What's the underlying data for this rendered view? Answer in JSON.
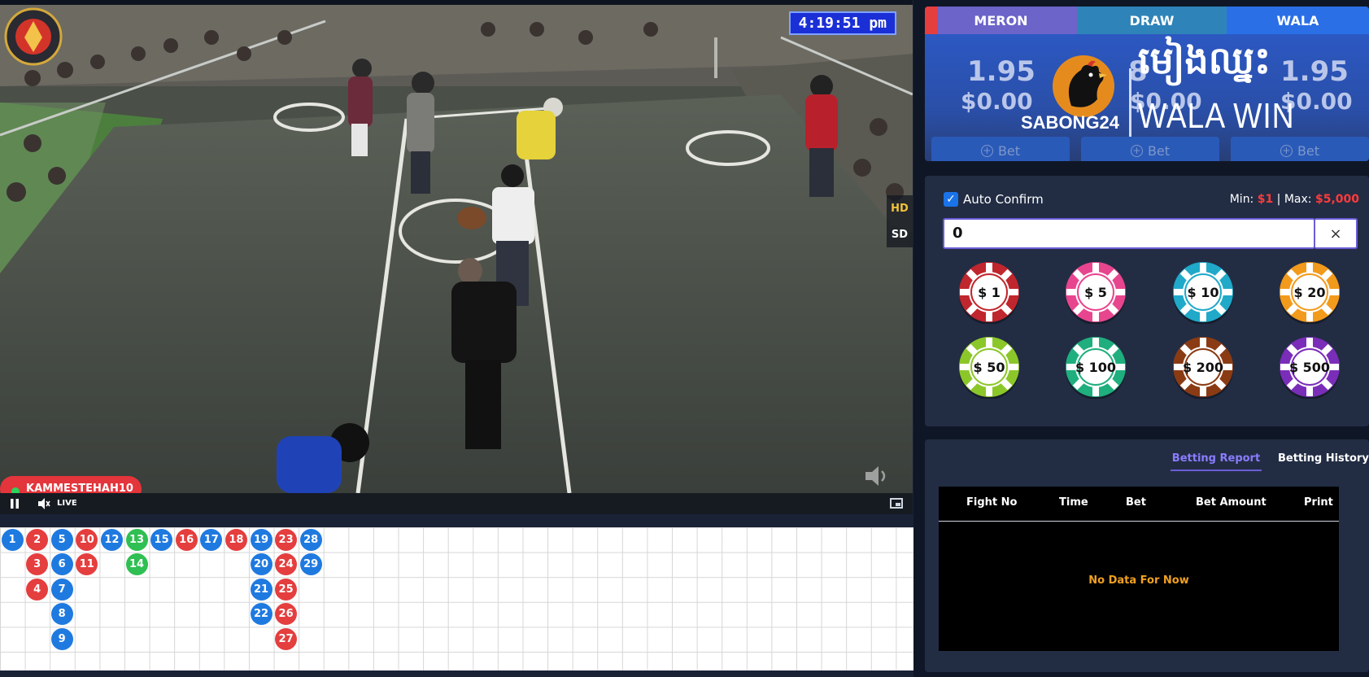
{
  "video": {
    "clock": "4:19:51 pm",
    "quality_hd": "HD",
    "quality_sd": "SD",
    "username": "KAMMESTEHAH10",
    "live_label": "LIVE"
  },
  "roadmap": {
    "beads": [
      {
        "n": "1",
        "c": "wala",
        "col": 0,
        "row": 0
      },
      {
        "n": "2",
        "c": "meron",
        "col": 1,
        "row": 0
      },
      {
        "n": "3",
        "c": "meron",
        "col": 1,
        "row": 1
      },
      {
        "n": "4",
        "c": "meron",
        "col": 1,
        "row": 2
      },
      {
        "n": "5",
        "c": "wala",
        "col": 2,
        "row": 0
      },
      {
        "n": "6",
        "c": "wala",
        "col": 2,
        "row": 1
      },
      {
        "n": "7",
        "c": "wala",
        "col": 2,
        "row": 2
      },
      {
        "n": "8",
        "c": "wala",
        "col": 2,
        "row": 3
      },
      {
        "n": "9",
        "c": "wala",
        "col": 2,
        "row": 4
      },
      {
        "n": "10",
        "c": "meron",
        "col": 3,
        "row": 0
      },
      {
        "n": "11",
        "c": "meron",
        "col": 3,
        "row": 1
      },
      {
        "n": "12",
        "c": "wala",
        "col": 4,
        "row": 0
      },
      {
        "n": "13",
        "c": "draw",
        "col": 5,
        "row": 0
      },
      {
        "n": "14",
        "c": "draw",
        "col": 5,
        "row": 1
      },
      {
        "n": "15",
        "c": "wala",
        "col": 6,
        "row": 0
      },
      {
        "n": "16",
        "c": "meron",
        "col": 7,
        "row": 0
      },
      {
        "n": "17",
        "c": "wala",
        "col": 8,
        "row": 0
      },
      {
        "n": "18",
        "c": "meron",
        "col": 9,
        "row": 0
      },
      {
        "n": "19",
        "c": "wala",
        "col": 10,
        "row": 0
      },
      {
        "n": "20",
        "c": "wala",
        "col": 10,
        "row": 1
      },
      {
        "n": "21",
        "c": "wala",
        "col": 10,
        "row": 2
      },
      {
        "n": "22",
        "c": "wala",
        "col": 10,
        "row": 3
      },
      {
        "n": "23",
        "c": "meron",
        "col": 11,
        "row": 0
      },
      {
        "n": "24",
        "c": "meron",
        "col": 11,
        "row": 1
      },
      {
        "n": "25",
        "c": "meron",
        "col": 11,
        "row": 2
      },
      {
        "n": "26",
        "c": "meron",
        "col": 11,
        "row": 3
      },
      {
        "n": "27",
        "c": "meron",
        "col": 11,
        "row": 4
      },
      {
        "n": "28",
        "c": "wala",
        "col": 12,
        "row": 0
      },
      {
        "n": "29",
        "c": "wala",
        "col": 12,
        "row": 1
      }
    ]
  },
  "board": {
    "meron_label": "MERON",
    "draw_label": "DRAW",
    "wala_label": "WALA",
    "meron_odds": "1.95",
    "draw_odds": "8",
    "wala_odds": "1.95",
    "meron_amount": "$0.00",
    "draw_amount": "$0.00",
    "wala_amount": "$0.00",
    "bet_label": "Bet",
    "overlay_brand": "SABONG24",
    "overlay_khmer": "មៀងឈ្នះ",
    "overlay_result": "WALA WIN"
  },
  "betpanel": {
    "auto_confirm": "Auto Confirm",
    "min_label": "Min:",
    "min_value": "$1",
    "max_label": "Max:",
    "max_value": "$5,000",
    "amount": "0",
    "clear": "×",
    "chips": [
      {
        "label": "$ 1",
        "color": "#c0262d"
      },
      {
        "label": "$ 5",
        "color": "#e8458f"
      },
      {
        "label": "$ 10",
        "color": "#20a9c9"
      },
      {
        "label": "$ 20",
        "color": "#f29a1c"
      },
      {
        "label": "$ 50",
        "color": "#8cc72a"
      },
      {
        "label": "$ 100",
        "color": "#1fae7e"
      },
      {
        "label": "$ 200",
        "color": "#8a3b14"
      },
      {
        "label": "$ 500",
        "color": "#7a2db8"
      }
    ]
  },
  "report": {
    "tab_report": "Betting Report",
    "tab_history": "Betting History",
    "col_fight": "Fight No",
    "col_time": "Time",
    "col_bet": "Bet",
    "col_amount": "Bet Amount",
    "col_print": "Print",
    "empty": "No Data For Now"
  },
  "colors": {
    "wala": "#1f7ae0",
    "meron": "#e53e3e",
    "draw": "#2fbf52",
    "accent": "#6b5cd6"
  }
}
